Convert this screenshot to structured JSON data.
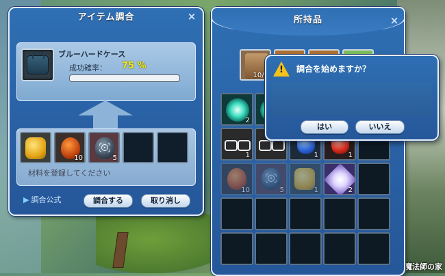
{
  "scene": {
    "location_label": "魔法師の家"
  },
  "craft_window": {
    "title": "アイテム調合",
    "close": "×",
    "target_item": {
      "name": "ブルーハードケース",
      "icon": "blue-case-icon"
    },
    "success_rate_label": "成功確率：",
    "success_rate_value": "75 %",
    "progress": 0,
    "materials": [
      {
        "icon": "yellow-pack-icon",
        "qty": ""
      },
      {
        "icon": "acorn-icon",
        "qty": "10"
      },
      {
        "icon": "speckled-gem-icon",
        "qty": "5"
      },
      {
        "icon": "",
        "qty": ""
      },
      {
        "icon": "",
        "qty": ""
      }
    ],
    "material_hint": "材料を登録してください",
    "formula_link": "調合公式",
    "craft_button": "調合する",
    "cancel_button": "取り消し"
  },
  "inventory_window": {
    "title": "所持品",
    "close": "×",
    "tab_qty_0": "10/1",
    "slots": [
      {
        "icon": "cyan-orb-icon",
        "qty": "2"
      },
      {
        "icon": "cyan-orb-icon",
        "qty": ""
      },
      {
        "icon": "",
        "qty": ""
      },
      {
        "icon": "",
        "qty": ""
      },
      {
        "icon": "",
        "qty": ""
      },
      {
        "icon": "glasses-icon",
        "qty": "1"
      },
      {
        "icon": "glasses-icon",
        "qty": ""
      },
      {
        "icon": "blue-gem-icon",
        "qty": "1"
      },
      {
        "icon": "red-gem-icon",
        "qty": "1"
      },
      {
        "icon": "",
        "qty": ""
      },
      {
        "icon": "acorn-icon",
        "qty": "10"
      },
      {
        "icon": "speckled-gem-icon",
        "qty": "5"
      },
      {
        "icon": "yellow-pack-icon",
        "qty": "1"
      },
      {
        "icon": "glitter-icon",
        "qty": "2"
      },
      {
        "icon": "",
        "qty": ""
      }
    ]
  },
  "confirm_dialog": {
    "message": "調合を始めますか？",
    "yes_button": "はい",
    "no_button": "いいえ",
    "icon": "warning-icon"
  }
}
